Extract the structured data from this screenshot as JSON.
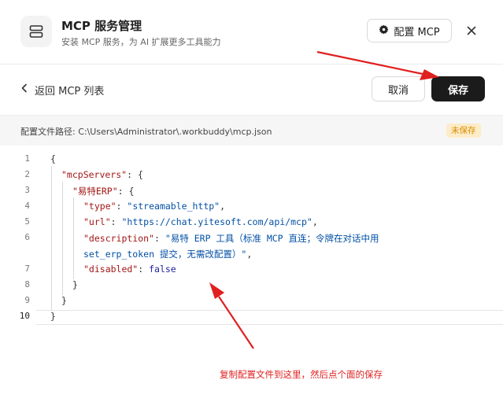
{
  "header": {
    "title": "MCP 服务管理",
    "subtitle": "安装 MCP 服务，为 AI 扩展更多工具能力",
    "configure_button": "配置 MCP",
    "close_icon": "close-icon"
  },
  "toolbar": {
    "back_label": "返回 MCP 列表",
    "cancel_label": "取消",
    "save_label": "保存"
  },
  "pathbar": {
    "label": "配置文件路径: C:\\Users\\Administrator\\.workbuddy\\mcp.json",
    "badge": "未保存"
  },
  "editor": {
    "line_numbers": [
      "1",
      "2",
      "3",
      "4",
      "5",
      "6",
      "7",
      "8",
      "9",
      "10"
    ],
    "lines": {
      "l1": "{",
      "l2_key": "\"mcpServers\"",
      "l2_rest": ": {",
      "l3_key": "\"易特ERP\"",
      "l3_rest": ": {",
      "l4_key": "\"type\"",
      "l4_sep": ": ",
      "l4_val": "\"streamable_http\"",
      "l4_end": ",",
      "l5_key": "\"url\"",
      "l5_sep": ": ",
      "l5_val": "\"https://chat.yitesoft.com/api/mcp\"",
      "l5_end": ",",
      "l6_key": "\"description\"",
      "l6_sep": ": ",
      "l6_val": "\"易特 ERP 工具（标准 MCP 直连；令牌在对话中用",
      "l6_wrap": "set_erp_token 提交，无需改配置）\"",
      "l6_end": ",",
      "l7_key": "\"disabled\"",
      "l7_sep": ": ",
      "l7_val": "false",
      "l8": "}",
      "l9": "}",
      "l10": "}"
    }
  },
  "annotation": {
    "text": "复制配置文件到这里，然后点个面的保存",
    "color": "#e02020"
  },
  "colors": {
    "save_button": "#1b1b1b",
    "badge_text": "#d98b00",
    "json_key": "#a31515",
    "json_string": "#0451a5",
    "json_bool": "#1f1f9f"
  }
}
